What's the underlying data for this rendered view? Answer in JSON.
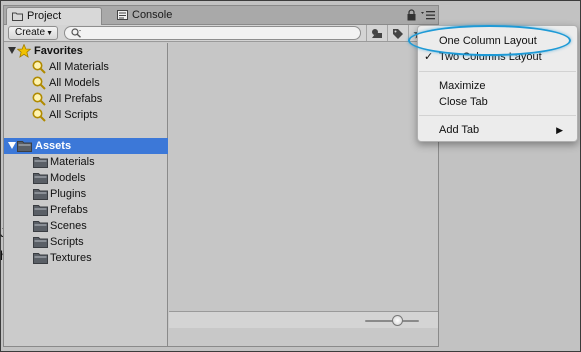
{
  "tabs": [
    {
      "label": "Project",
      "icon": "folder-icon",
      "active": true
    },
    {
      "label": "Console",
      "icon": "console-icon",
      "active": false
    }
  ],
  "toolbar": {
    "create_label": "Create",
    "search_placeholder": "",
    "tool_icons": [
      "filter-by-type-icon",
      "filter-by-label-icon",
      "favorite-search-icon"
    ]
  },
  "favorites": {
    "title": "Favorites",
    "items": [
      "All Materials",
      "All Models",
      "All Prefabs",
      "All Scripts"
    ]
  },
  "assets": {
    "title": "Assets",
    "folders": [
      "Materials",
      "Models",
      "Plugins",
      "Prefabs",
      "Scenes",
      "Scripts",
      "Textures"
    ]
  },
  "context_menu": {
    "items": [
      {
        "label": "One Column Layout",
        "checked": false,
        "highlighted": true
      },
      {
        "label": "Two Columns Layout",
        "checked": true
      },
      {
        "label": "Maximize"
      },
      {
        "label": "Close Tab"
      },
      {
        "label": "Add Tab",
        "submenu": true
      }
    ],
    "check_glyph": "✓",
    "submenu_glyph": "▶"
  },
  "zoom_slider_value": 0.6,
  "colors": {
    "selection": "#3c78d8",
    "highlight_ring": "#1e9ad6",
    "folder": "#555a60",
    "favorite_star": "#f2c200"
  }
}
